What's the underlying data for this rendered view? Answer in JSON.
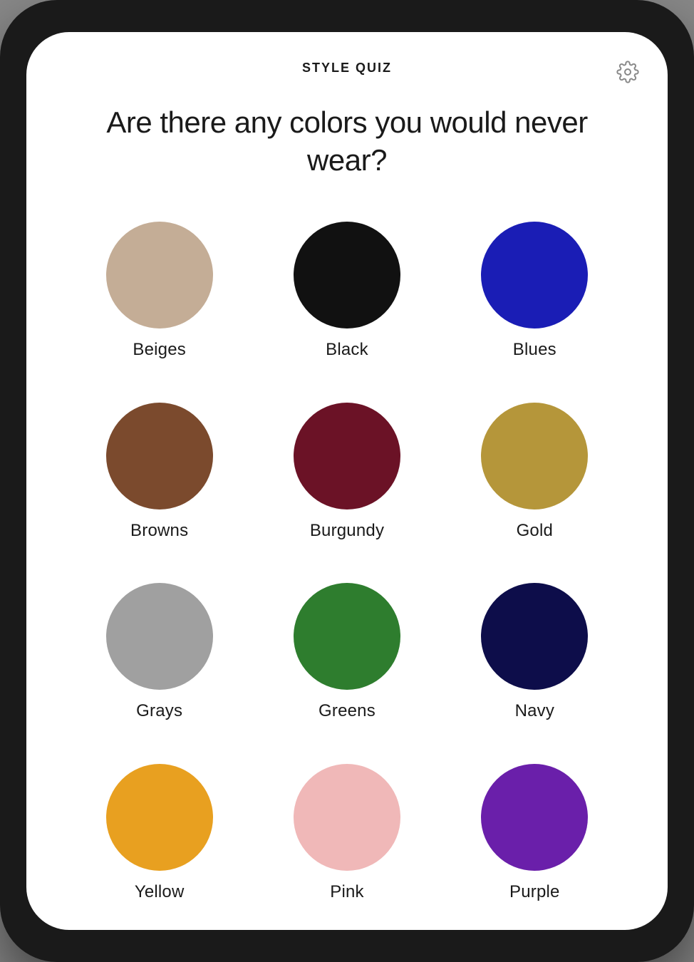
{
  "header": {
    "title": "STYLE QUIZ",
    "settings_icon": "gear-icon"
  },
  "question": {
    "text": "Are there any colors you would never wear?"
  },
  "colors": [
    {
      "id": "beiges",
      "label": "Beiges",
      "hex": "#C4AD96"
    },
    {
      "id": "black",
      "label": "Black",
      "hex": "#111111"
    },
    {
      "id": "blues",
      "label": "Blues",
      "hex": "#1A1DB5"
    },
    {
      "id": "browns",
      "label": "Browns",
      "hex": "#7B4A2D"
    },
    {
      "id": "burgundy",
      "label": "Burgundy",
      "hex": "#6B1226"
    },
    {
      "id": "gold",
      "label": "Gold",
      "hex": "#B5963A"
    },
    {
      "id": "grays",
      "label": "Grays",
      "hex": "#A0A0A0"
    },
    {
      "id": "greens",
      "label": "Greens",
      "hex": "#2E7D2E"
    },
    {
      "id": "navy",
      "label": "Navy",
      "hex": "#0D0D4A"
    },
    {
      "id": "yellow",
      "label": "Yellow",
      "hex": "#E8A020"
    },
    {
      "id": "pink",
      "label": "Pink",
      "hex": "#F0B8B8"
    },
    {
      "id": "purple",
      "label": "Purple",
      "hex": "#6A1FAA"
    }
  ]
}
